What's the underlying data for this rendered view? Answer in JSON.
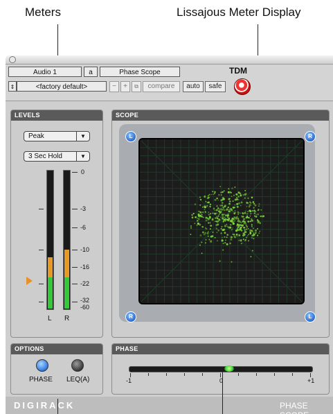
{
  "callouts": {
    "meters": "Meters",
    "lissajous": "Lissajous Meter Display"
  },
  "header": {
    "track": "Audio 1",
    "insert": "a",
    "plugin_name": "Phase Scope",
    "preset": "<factory default>",
    "minus": "−",
    "plus": "+",
    "compare": "compare",
    "auto": "auto",
    "safe": "safe",
    "tdm": "TDM"
  },
  "levels": {
    "title": "LEVELS",
    "mode": "Peak",
    "hold": "3 Sec Hold",
    "scale": [
      "0",
      "-3",
      "-6",
      "-10",
      "-16",
      "-22",
      "-32",
      "-60"
    ],
    "left_label": "L",
    "right_label": "R",
    "left_level_fraction": 0.23,
    "right_level_fraction": 0.24,
    "clip_indicator_color": "#e8902a"
  },
  "scope": {
    "title": "SCOPE",
    "corner_tl": "L",
    "corner_tr": "R",
    "corner_bl": "R",
    "corner_br": "L",
    "trace_color": "#7fd83a"
  },
  "options": {
    "title": "OPTIONS",
    "phase_label": "PHASE",
    "leqa_label": "LEQ(A)",
    "phase_on": true,
    "leqa_on": false
  },
  "phase": {
    "title": "PHASE",
    "min": "-1",
    "mid": "0",
    "max": "+1",
    "value": 0.1
  },
  "footer": {
    "brand": "DIGIRACK",
    "plugin": "PHASE SCOPE"
  }
}
